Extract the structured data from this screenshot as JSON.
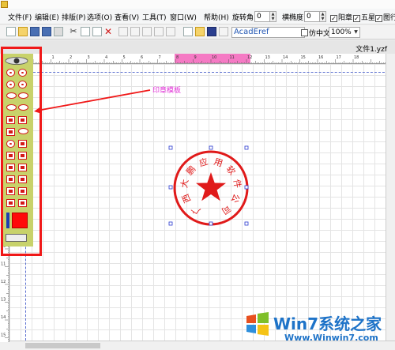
{
  "menu": [
    "文件(F)",
    "编辑(E)",
    "排版(P)",
    "选项(O)",
    "查看(V)",
    "工具(T)",
    "窗口(W)",
    "帮助(H)"
  ],
  "controls": {
    "rotate_label": "旋转角:",
    "rotate_value": "0",
    "aspect_label": "横椭度:",
    "aspect_value": "0",
    "check_yang": "阳章",
    "check_star": "五星",
    "check_frame": "图行"
  },
  "toolbar": {
    "font_value": "AcadEref",
    "checkbox_label": "仿中文",
    "zoom_value": "100%"
  },
  "document": {
    "tab_label": "文件1.yzf"
  },
  "annotation": {
    "label": "印章模板"
  },
  "seal": {
    "text": "广西大鹏应用软件公司",
    "color": "#e01a1a"
  },
  "ruler": {
    "top_ticks": [
      "1",
      "2",
      "3",
      "4",
      "5",
      "6",
      "7",
      "8",
      "9",
      "10",
      "11",
      "12",
      "13",
      "14",
      "15",
      "16",
      "17",
      "18"
    ],
    "left_ticks": [
      "1",
      "2",
      "3",
      "4",
      "5",
      "6",
      "7",
      "8",
      "9",
      "10",
      "11",
      "12",
      "13",
      "14",
      "15",
      "16",
      "17"
    ]
  },
  "watermark": {
    "title": "Win7系统之家",
    "url": "Www.Winwin7.com"
  },
  "colors": {
    "highlight": "#f01818",
    "annotation": "#e233d8",
    "ruler_highlight": "#f57ac4",
    "margin_line": "#5b6fd0"
  }
}
